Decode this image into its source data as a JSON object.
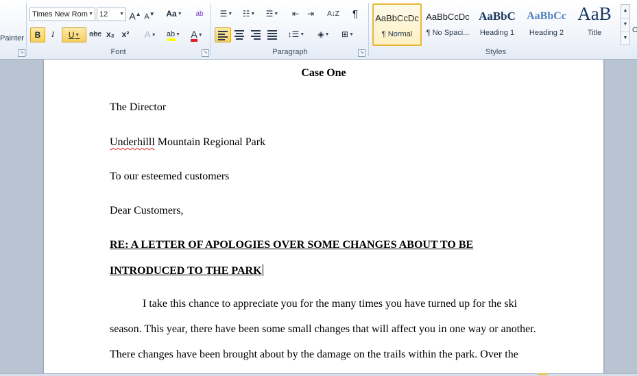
{
  "ribbon": {
    "clipboard": {
      "format_painter_label": "Painter"
    },
    "font": {
      "group_label": "Font",
      "font_name": "Times New Rom",
      "font_size": "12",
      "grow_font": "A",
      "shrink_font": "A",
      "change_case": "Aa",
      "clear_formatting": "ab",
      "bold": "B",
      "italic": "I",
      "underline": "U",
      "strikethrough": "abc",
      "subscript": "x₂",
      "superscript": "x²",
      "text_effects": "A",
      "highlight": "ab",
      "font_color": "A"
    },
    "paragraph": {
      "group_label": "Paragraph",
      "sort": "A↓Z",
      "show_marks": "¶"
    },
    "styles": {
      "group_label": "Styles",
      "items": [
        {
          "sample": "AaBbCcDc",
          "name": "¶ Normal"
        },
        {
          "sample": "AaBbCcDc",
          "name": "¶ No Spaci..."
        },
        {
          "sample": "AaBbC",
          "name": "Heading 1"
        },
        {
          "sample": "AaBbCc",
          "name": "Heading 2"
        },
        {
          "sample": "AaB",
          "name": "Title"
        }
      ],
      "right_edge_label": "C"
    }
  },
  "document": {
    "title": "Case One",
    "line1": "The Director",
    "line2_misspelled": "Underhilll",
    "line2_rest": " Mountain Regional Park",
    "line3": "To our esteemed customers",
    "line4": "Dear Customers,",
    "heading_line1": "RE: A LETTER OF APOLOGIES OVER SOME CHANGES ABOUT TO BE",
    "heading_line2": "INTRODUCED TO THE PARK",
    "para_line1": "I take this chance to appreciate you for the many times you have turned up for the ski",
    "para_line2": "season. This year, there have been some small  changes that will affect you in one way or another.",
    "para_line3": "There changes have been brought about by the damage on the trails within the park. Over the"
  },
  "colors": {
    "ribbon_bg": "#f3f6fb",
    "active_button": "#f7cf5d",
    "highlight_color": "#ffff00",
    "font_color": "#e01b1b",
    "workspace_bg": "#b9c4d2",
    "heading1_color": "#17365d",
    "heading2_color": "#4f81bd",
    "title_color": "#17365d"
  }
}
